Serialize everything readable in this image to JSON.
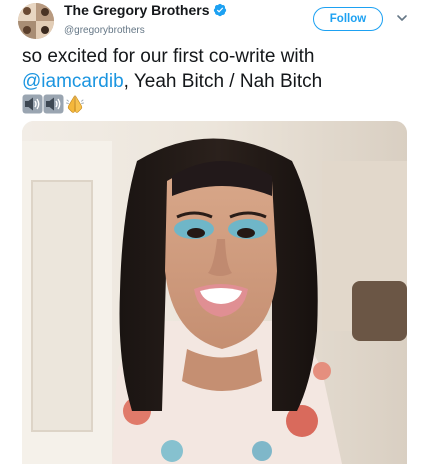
{
  "tweet": {
    "display_name": "The Gregory Brothers",
    "handle": "@gregorybrothers",
    "verified": true,
    "follow_label": "Follow",
    "text_line1": "so excited for our first co-write with",
    "mention": "@iamcardib",
    "text_line2_rest": ", Yeah Bitch / Nah Bitch",
    "emojis": [
      "speaker-icon",
      "speaker-icon",
      "folded-hands-icon"
    ]
  },
  "colors": {
    "accent": "#1da1f2",
    "mention": "#1b95e0",
    "text": "#14171a",
    "muted": "#657786"
  },
  "icons": {
    "verified": "verified-badge-icon",
    "caret": "chevron-down-icon"
  }
}
